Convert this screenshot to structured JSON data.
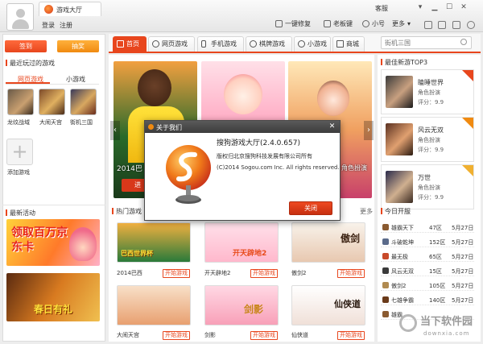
{
  "titlebar": {
    "app_title": "游戏大厅",
    "login": "登录",
    "register": "注册",
    "service": "客服",
    "actions": [
      "一键修复",
      "老板键",
      "小号",
      "更多"
    ],
    "more_arrow": "▾"
  },
  "left": {
    "signin": "签到",
    "lottery": "抽奖",
    "recent_title": "最近玩过的游戏",
    "subtabs": [
      "网页游戏",
      "小游戏"
    ],
    "recent_games": [
      "龙纹战域",
      "大闹天宫",
      "街机三国"
    ],
    "add_game": "添加游戏",
    "add_symbol": "+",
    "events_title": "最新活动",
    "promo1_text": "领取百万京东卡",
    "promo2_text": "春日有礼"
  },
  "nav": {
    "tabs": [
      "首页",
      "网页游戏",
      "手机游戏",
      "棋牌游戏",
      "小游戏",
      "商城"
    ],
    "search_placeholder": "街机三国"
  },
  "banners": {
    "caption": "2014巴",
    "btn1": "进",
    "arrow_left": "‹",
    "arrow_right": "›",
    "role_text": "角色扮演"
  },
  "hot": {
    "title": "热门游戏",
    "more": "更多",
    "play_label": "开始游戏",
    "games": [
      {
        "name": "2014巴西",
        "art": "巴西世界杯"
      },
      {
        "name": "开天辟地2",
        "art": "开天辟地2"
      },
      {
        "name": "傲剑2",
        "art": "傲剑"
      },
      {
        "name": "大闹天宫",
        "art": ""
      },
      {
        "name": "剑影",
        "art": "剑影"
      },
      {
        "name": "仙侠道",
        "art": "仙侠道"
      }
    ]
  },
  "right": {
    "top3_title": "最佳新游TOP3",
    "top3": [
      {
        "name": "瞌睡世界",
        "cat": "角色扮演",
        "score": "评分：9.9",
        "rank": "1"
      },
      {
        "name": "风云无双",
        "cat": "角色扮演",
        "score": "评分：9.9",
        "rank": "2"
      },
      {
        "name": "万世",
        "cat": "角色扮演",
        "score": "评分：9.9",
        "rank": "3"
      }
    ],
    "servers_title": "今日开服",
    "servers": [
      {
        "name": "雄霸天下",
        "zone": "47区",
        "date": "5月27日"
      },
      {
        "name": "斗破乾坤",
        "zone": "152区",
        "date": "5月27日"
      },
      {
        "name": "最无极",
        "zone": "65区",
        "date": "5月27日"
      },
      {
        "name": "风云无双",
        "zone": "15区",
        "date": "5月27日"
      },
      {
        "name": "傲剑2",
        "zone": "105区",
        "date": "5月27日"
      },
      {
        "name": "七雄争霸",
        "zone": "140区",
        "date": "5月27日"
      },
      {
        "name": "雄霸",
        "zone": "",
        "date": ""
      }
    ]
  },
  "dialog": {
    "title": "关于我们",
    "close": "✕",
    "product": "搜狗游戏大厅(2.4.0.657)",
    "line1": "版权归北京搜狗科技发展有限公司所有",
    "line2": "(C)2014 Sogou.com Inc. All rights reserved.",
    "ok": "关闭"
  },
  "watermark": {
    "text": "当下软件园",
    "url": "downxia.com"
  },
  "colors": {
    "accent": "#e8461d",
    "dialog_title": "#3c3c3c"
  }
}
